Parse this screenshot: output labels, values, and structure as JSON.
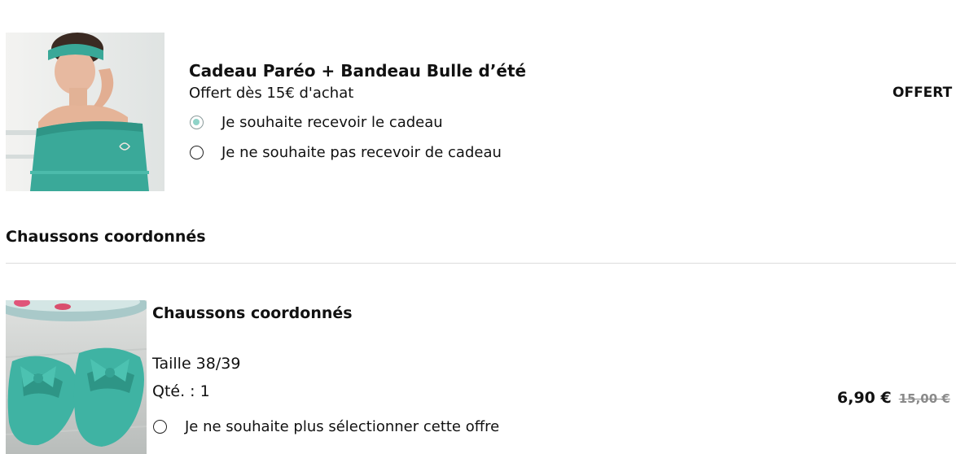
{
  "gift": {
    "title": "Cadeau Paréo + Bandeau Bulle d’été",
    "subtitle": "Offert dès 15€ d'achat",
    "price": "OFFERT",
    "options": [
      {
        "label": "Je souhaite recevoir le cadeau",
        "selected": true
      },
      {
        "label": "Je ne souhaite pas recevoir de cadeau",
        "selected": false
      }
    ]
  },
  "section": {
    "title": "Chaussons coordonnés"
  },
  "product": {
    "name": "Chaussons coordonnés",
    "size": "Taille 38/39",
    "quantity": "Qté. : 1",
    "price": "6,90 €",
    "old_price": "15,00 €",
    "option": {
      "label": "Je ne souhaite plus sélectionner cette offre",
      "selected": false
    }
  },
  "colors": {
    "radio_selected": "#8fd3c8",
    "divider": "#dcdcdc",
    "old_price": "#8a8a8a",
    "product_teal": "#3fb3a3"
  },
  "icons": {
    "radio": "radio-button"
  }
}
